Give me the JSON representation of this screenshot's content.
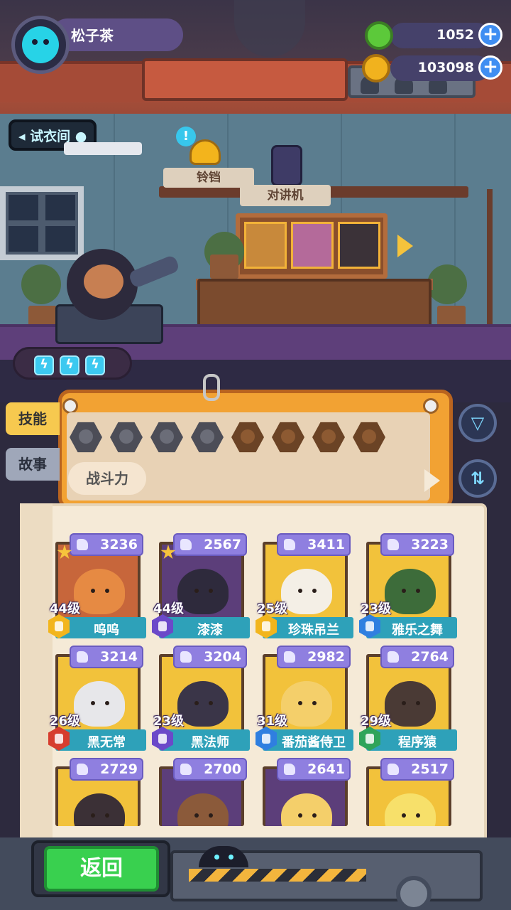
{
  "player": {
    "name": "松子茶"
  },
  "currencies": [
    {
      "icon": "green-gem-icon",
      "value": "1052",
      "color": "#5cc93a"
    },
    {
      "icon": "gold-coin-icon",
      "value": "103098",
      "color": "#f1b21e"
    }
  ],
  "room": {
    "title": "试衣间",
    "items": [
      {
        "label": "铃铛",
        "icon": "bell-icon"
      },
      {
        "label": "对讲机",
        "icon": "walkie-talkie-icon"
      }
    ],
    "energy_count": 3
  },
  "filter_panel": {
    "tabs": [
      {
        "label": "技能",
        "active": true
      },
      {
        "label": "故事",
        "active": false
      }
    ],
    "filter_icons": [
      "heart-icon",
      "rocket-icon",
      "shield-icon",
      "anchor-icon",
      "explosion-icon",
      "smile-icon",
      "muscle-icon",
      "brain-icon"
    ],
    "sort_chip": "战斗力",
    "buttons": [
      "filter-funnel-icon",
      "sort-swap-icon"
    ]
  },
  "roster": [
    {
      "name": "呜呜",
      "level": "44级",
      "power": "3236",
      "starred": true,
      "badge_color": "#f2b51d",
      "art_bg": "#c7663b",
      "art_color": "#e68a43"
    },
    {
      "name": "漆漆",
      "level": "44级",
      "power": "2567",
      "starred": true,
      "badge_color": "#6b49c9",
      "art_bg": "#5c3e7a",
      "art_color": "#2e2a3c"
    },
    {
      "name": "珍珠吊兰",
      "level": "25级",
      "power": "3411",
      "starred": false,
      "badge_color": "#f2b51d",
      "art_bg": "#f2c23b",
      "art_color": "#f4efe6"
    },
    {
      "name": "雅乐之舞",
      "level": "23级",
      "power": "3223",
      "starred": false,
      "badge_color": "#2f7fe0",
      "art_bg": "#f2c23b",
      "art_color": "#3d6c3a"
    },
    {
      "name": "黑无常",
      "level": "26级",
      "power": "3214",
      "starred": false,
      "badge_color": "#d63d2e",
      "art_bg": "#f2c23b",
      "art_color": "#e7e7ea"
    },
    {
      "name": "黑法师",
      "level": "23级",
      "power": "3204",
      "starred": false,
      "badge_color": "#6b49c9",
      "art_bg": "#f2c23b",
      "art_color": "#3a3548"
    },
    {
      "name": "番茄酱侍卫",
      "level": "31级",
      "power": "2982",
      "starred": false,
      "badge_color": "#2f7fe0",
      "art_bg": "#f2c23b",
      "art_color": "#f4cf6a"
    },
    {
      "name": "程序猿",
      "level": "29级",
      "power": "2764",
      "starred": false,
      "badge_color": "#2fa45a",
      "art_bg": "#f2c23b",
      "art_color": "#4a3a35"
    },
    {
      "name": "",
      "level": "",
      "power": "2729",
      "starred": false,
      "badge_color": "",
      "art_bg": "#f2c23b",
      "art_color": "#3b3036"
    },
    {
      "name": "",
      "level": "",
      "power": "2700",
      "starred": false,
      "badge_color": "",
      "art_bg": "#5c3e7a",
      "art_color": "#8b5a3a"
    },
    {
      "name": "",
      "level": "",
      "power": "2641",
      "starred": false,
      "badge_color": "",
      "art_bg": "#5c3e7a",
      "art_color": "#f4cf6a"
    },
    {
      "name": "",
      "level": "",
      "power": "2517",
      "starred": false,
      "badge_color": "",
      "art_bg": "#f2c23b",
      "art_color": "#f7e06a"
    }
  ],
  "bottom": {
    "back_label": "返回"
  }
}
